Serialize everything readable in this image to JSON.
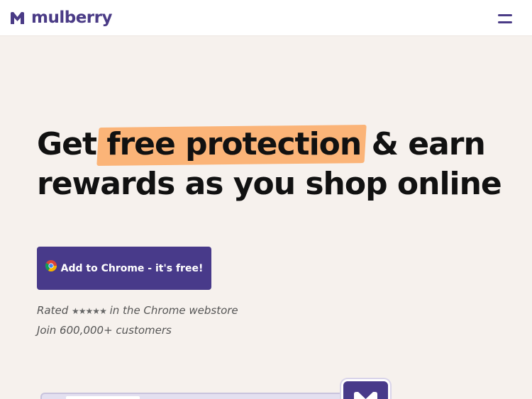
{
  "header": {
    "brand": "mulberry",
    "logo_icon": "mulberry-m-logo",
    "menu_icon": "hamburger-menu-icon"
  },
  "hero": {
    "title_before": "Get",
    "title_highlight": "free protection",
    "title_after": "& earn",
    "title_line2": "rewards as you shop online"
  },
  "cta": {
    "label": "Add to Chrome - it's free!",
    "icon": "chrome-icon"
  },
  "rating": {
    "prefix": "Rated",
    "stars": "★★★★★",
    "suffix": "in the Chrome webstore"
  },
  "customers": "Join 600,000+ customers",
  "colors": {
    "brand": "#483a8a",
    "highlight": "#fbb478",
    "background": "#f6f1ed"
  }
}
